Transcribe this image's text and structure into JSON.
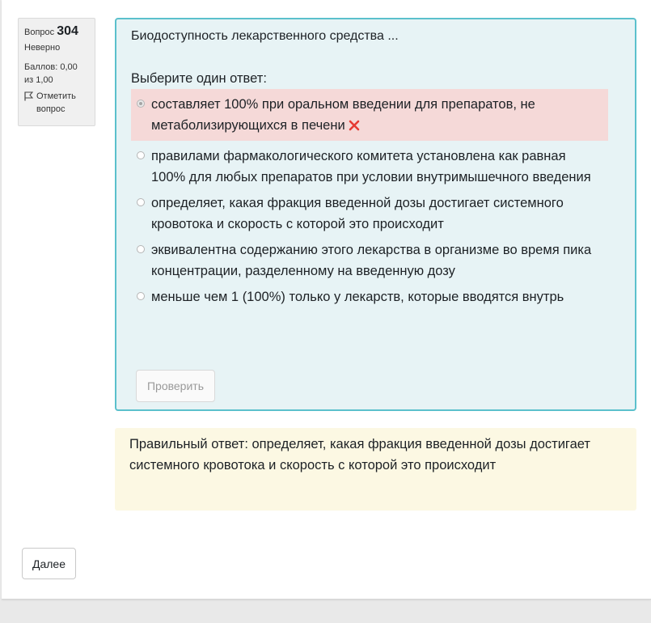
{
  "info": {
    "question_label": "Вопрос",
    "question_number": "304",
    "state": "Неверно",
    "grade": "Баллов: 0,00 из 1,00",
    "flag_label": "Отметить вопрос"
  },
  "question": {
    "text": "Биодоступность лекарственного средства ...",
    "prompt": "Выберите один ответ:",
    "answers": [
      {
        "label": "составляет 100% при оральном введении для препаратов, не метаболизирующихся в печени",
        "selected": true,
        "status": "incorrect"
      },
      {
        "label": "правилами фармакологического комитета установлена как равная 100% для любых препаратов при условии внутримышечного введения",
        "selected": false
      },
      {
        "label": "определяет, какая фракция введенной дозы достигает системного кровотока и скорость с которой это происходит",
        "selected": false
      },
      {
        "label": "эквивалентна содержанию этого лекарства в организме во время пика концентрации, разделенному на введенную дозу",
        "selected": false
      },
      {
        "label": "меньше чем 1 (100%) только у лекарств, которые вводятся внутрь",
        "selected": false
      }
    ],
    "check_button": "Проверить"
  },
  "feedback": {
    "right_answer": "Правильный ответ: определяет, какая фракция введенной дозы достигает системного кровотока и скорость с которой это происходит"
  },
  "navigation": {
    "next_button": "Далее"
  },
  "colors": {
    "formulation_bg": "#e7f3f5",
    "formulation_border": "#5bc0cc",
    "incorrect_bg": "#f5d9d8",
    "incorrect_icon": "#e63a33",
    "feedback_bg": "#fcf8e3"
  }
}
